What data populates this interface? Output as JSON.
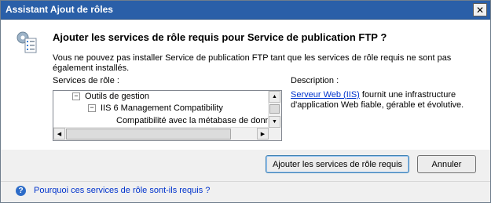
{
  "window": {
    "title": "Assistant Ajout de rôles",
    "close_glyph": "✕"
  },
  "heading": "Ajouter les services de rôle requis pour Service de publication FTP ?",
  "message": "Vous ne pouvez pas installer Service de publication FTP tant que les services de rôle requis ne sont pas également installés.",
  "services": {
    "label": "Services de rôle :",
    "tree": [
      {
        "text": "Outils de gestion",
        "toggle": "−",
        "level": 1
      },
      {
        "text": "IIS 6 Management Compatibility",
        "toggle": "−",
        "level": 2
      },
      {
        "text": "Compatibilité avec la métabase de donné",
        "toggle": "",
        "level": 3
      }
    ]
  },
  "description": {
    "label": "Description :",
    "link_text": "Serveur Web (IIS)",
    "text": " fournit une infrastructure d'application Web fiable, gérable et évolutive."
  },
  "buttons": {
    "add": "Ajouter les services de rôle requis",
    "cancel": "Annuler"
  },
  "footer": {
    "help_link": "Pourquoi ces services de rôle sont-ils requis ?",
    "help_icon": "?"
  },
  "icons": {
    "wizard": "add-roles-wizard-icon",
    "help": "help-icon"
  },
  "colors": {
    "titlebar": "#2a5fa8",
    "link": "#0033cc"
  }
}
